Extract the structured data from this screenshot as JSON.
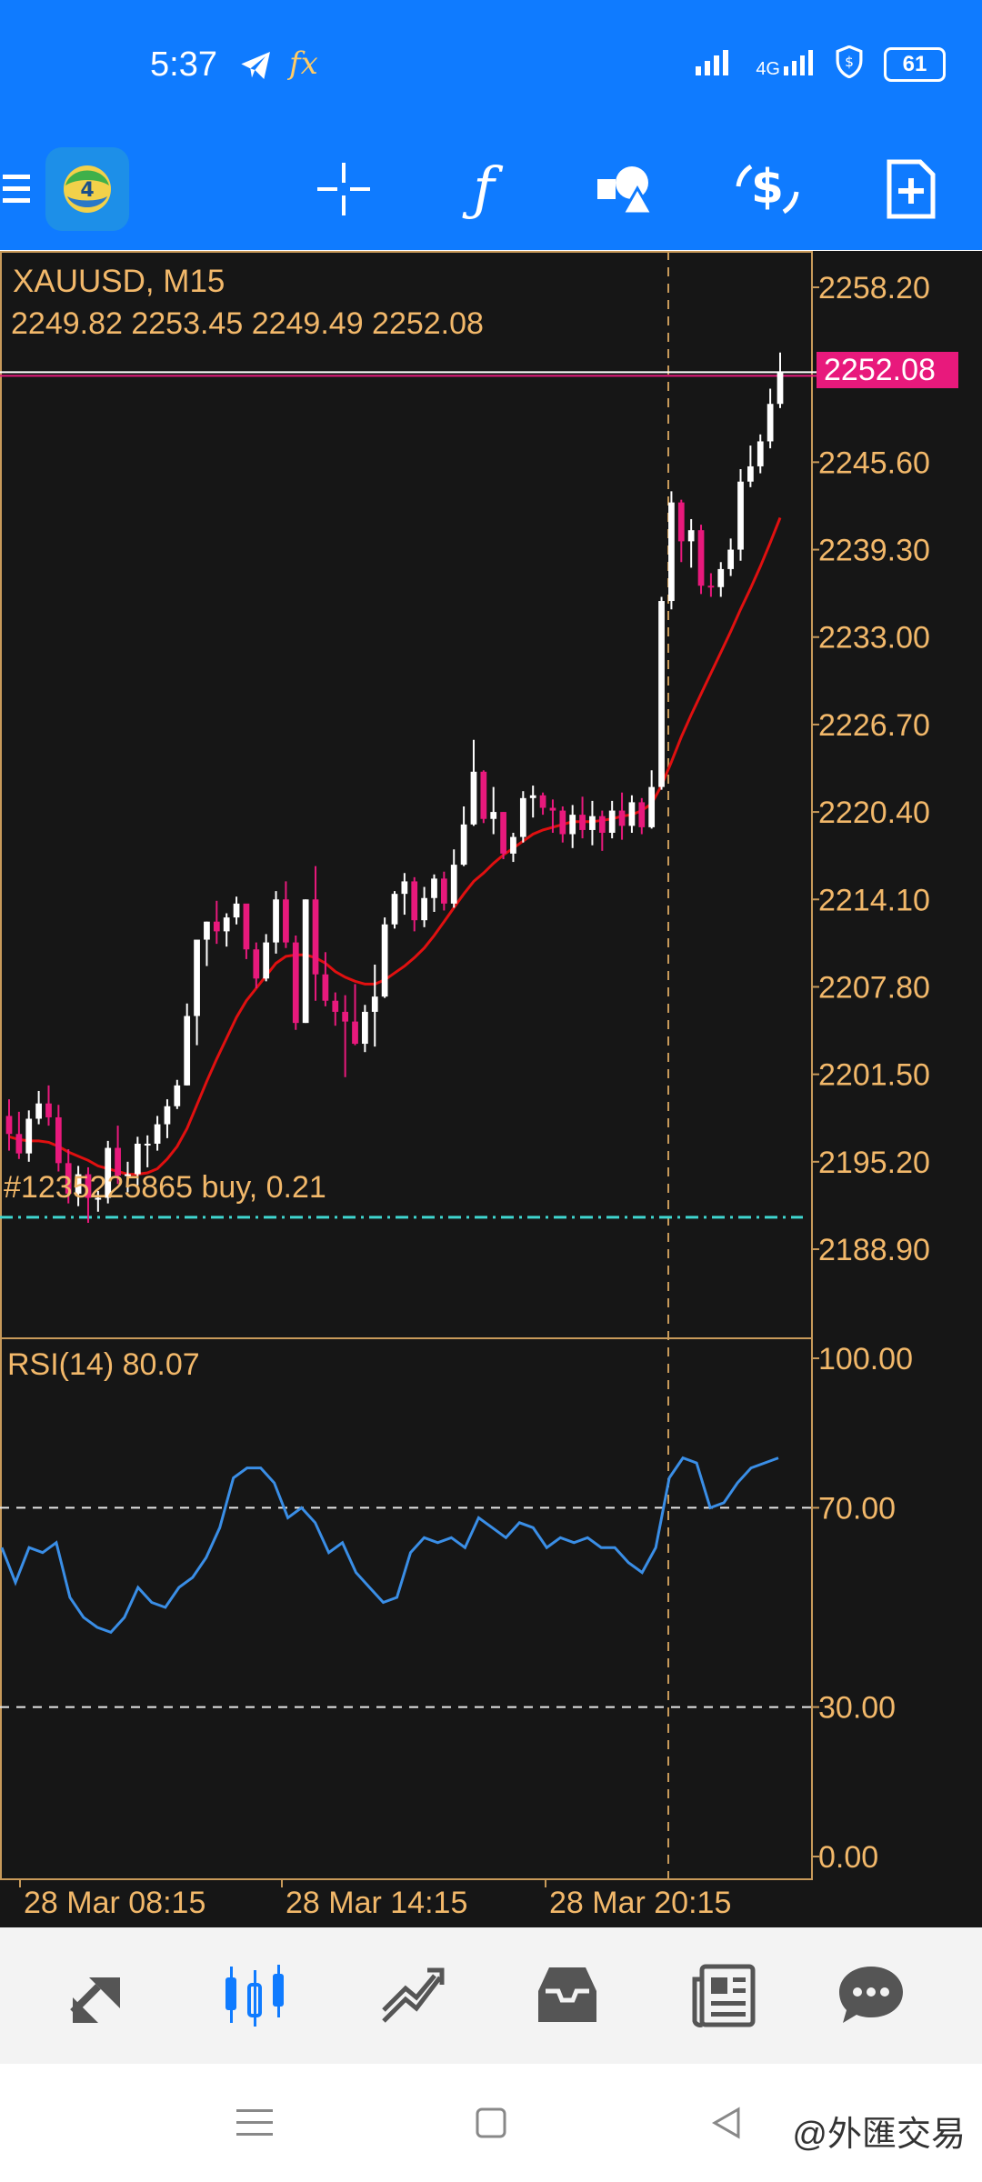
{
  "status_bar": {
    "time": "5:37",
    "network": "4G",
    "battery": "61"
  },
  "toolbar": {
    "icons": [
      "menu-icon",
      "app-logo",
      "crosshair-icon",
      "indicators-icon",
      "objects-icon",
      "trade-icon",
      "new-order-icon"
    ]
  },
  "chart": {
    "symbol": "XAUUSD, M15",
    "ohlc": "2249.82 2253.45 2249.49 2252.08",
    "current_price": "2252.08",
    "price_ticks": [
      "2258.20",
      "2245.60",
      "2239.30",
      "2233.00",
      "2226.70",
      "2220.40",
      "2214.10",
      "2207.80",
      "2201.50",
      "2195.20",
      "2188.90"
    ],
    "order_label": "#1235225865 buy, 0.21",
    "rsi_label": "RSI(14) 80.07",
    "rsi_ticks": [
      "100.00",
      "70.00",
      "30.00",
      "0.00"
    ],
    "time_labels": [
      "28 Mar 08:15",
      "28 Mar 14:15",
      "28 Mar 20:15"
    ],
    "colors": {
      "bull": "#ffffff",
      "bear": "#e8197c",
      "ma": "#e01010",
      "rsi": "#3a8ee6",
      "axis": "#c89a5a",
      "text": "#f2b86a",
      "price_tag": "#e8197c",
      "order_line": "#3fd6d0"
    }
  },
  "chart_data": {
    "type": "candlestick",
    "symbol": "XAUUSD",
    "timeframe": "M15",
    "ylim": [
      2186.5,
      2259.5
    ],
    "current": 2252.08,
    "order_price": 2191.2,
    "candles": [
      [
        2198.5,
        2199.7,
        2196.0,
        2197.2
      ],
      [
        2197.2,
        2198.8,
        2195.4,
        2195.8
      ],
      [
        2195.8,
        2198.9,
        2195.2,
        2198.3
      ],
      [
        2198.3,
        2200.3,
        2197.9,
        2199.4
      ],
      [
        2199.4,
        2200.7,
        2197.8,
        2198.4
      ],
      [
        2198.4,
        2199.3,
        2194.5,
        2195.1
      ],
      [
        2195.1,
        2196.1,
        2192.2,
        2192.9
      ],
      [
        2192.9,
        2194.9,
        2192.0,
        2194.3
      ],
      [
        2194.3,
        2194.8,
        2190.8,
        2192.6
      ],
      [
        2192.6,
        2193.1,
        2191.6,
        2192.6
      ],
      [
        2192.6,
        2196.7,
        2192.2,
        2196.2
      ],
      [
        2196.2,
        2197.8,
        2193.6,
        2194.2
      ],
      [
        2194.2,
        2195.2,
        2193.0,
        2194.3
      ],
      [
        2194.3,
        2197.0,
        2193.5,
        2196.5
      ],
      [
        2196.5,
        2197.1,
        2194.8,
        2196.5
      ],
      [
        2196.5,
        2198.5,
        2196.0,
        2197.9
      ],
      [
        2197.9,
        2199.7,
        2196.9,
        2199.2
      ],
      [
        2199.2,
        2201.1,
        2199.0,
        2200.7
      ],
      [
        2200.7,
        2206.6,
        2200.7,
        2205.7
      ],
      [
        2205.7,
        2211.1,
        2203.6,
        2211.2
      ],
      [
        2211.2,
        2212.5,
        2209.3,
        2212.5
      ],
      [
        2212.5,
        2214.0,
        2210.9,
        2211.8
      ],
      [
        2211.8,
        2213.1,
        2210.7,
        2212.8
      ],
      [
        2212.8,
        2214.3,
        2212.3,
        2213.8
      ],
      [
        2213.8,
        2213.5,
        2209.8,
        2210.5
      ],
      [
        2210.5,
        2211.0,
        2207.7,
        2208.4
      ],
      [
        2208.4,
        2211.6,
        2208.2,
        2211.0
      ],
      [
        2211.0,
        2214.7,
        2210.2,
        2214.1
      ],
      [
        2214.1,
        2215.4,
        2210.6,
        2211.0
      ],
      [
        2211.0,
        2211.5,
        2204.7,
        2205.2
      ],
      [
        2205.2,
        2214.1,
        2205.2,
        2214.1
      ],
      [
        2214.1,
        2216.5,
        2206.8,
        2208.7
      ],
      [
        2208.7,
        2210.3,
        2206.4,
        2206.8
      ],
      [
        2206.8,
        2207.4,
        2205.0,
        2206.0
      ],
      [
        2206.0,
        2207.2,
        2201.3,
        2205.3
      ],
      [
        2205.3,
        2208.0,
        2203.6,
        2203.7
      ],
      [
        2203.7,
        2206.5,
        2203.1,
        2206.0
      ],
      [
        2206.0,
        2209.4,
        2203.5,
        2207.1
      ],
      [
        2207.1,
        2212.8,
        2207.0,
        2212.3
      ],
      [
        2212.3,
        2214.7,
        2212.0,
        2214.5
      ],
      [
        2214.5,
        2216.0,
        2213.0,
        2215.4
      ],
      [
        2215.4,
        2215.7,
        2211.8,
        2212.6
      ],
      [
        2212.6,
        2215.0,
        2212.1,
        2214.2
      ],
      [
        2214.2,
        2215.9,
        2213.2,
        2215.6
      ],
      [
        2215.6,
        2216.1,
        2213.3,
        2213.8
      ],
      [
        2213.8,
        2217.7,
        2213.5,
        2216.6
      ],
      [
        2216.6,
        2220.8,
        2216.5,
        2219.5
      ],
      [
        2219.5,
        2225.6,
        2219.4,
        2223.3
      ],
      [
        2223.3,
        2223.4,
        2219.6,
        2219.9
      ],
      [
        2219.9,
        2222.2,
        2218.8,
        2220.4
      ],
      [
        2220.4,
        2220.4,
        2217.0,
        2217.4
      ],
      [
        2217.4,
        2218.9,
        2216.8,
        2218.6
      ],
      [
        2218.6,
        2221.9,
        2218.2,
        2221.4
      ],
      [
        2221.4,
        2222.3,
        2220.0,
        2221.6
      ],
      [
        2221.6,
        2221.8,
        2220.2,
        2220.7
      ],
      [
        2220.7,
        2221.3,
        2218.9,
        2220.5
      ],
      [
        2220.5,
        2220.8,
        2218.2,
        2218.8
      ],
      [
        2218.8,
        2220.9,
        2217.8,
        2220.2
      ],
      [
        2220.2,
        2221.5,
        2218.5,
        2219.1
      ],
      [
        2219.1,
        2221.2,
        2218.0,
        2220.1
      ],
      [
        2220.1,
        2220.5,
        2217.6,
        2218.9
      ],
      [
        2218.9,
        2221.2,
        2218.5,
        2220.5
      ],
      [
        2220.5,
        2221.8,
        2218.4,
        2219.4
      ],
      [
        2219.4,
        2221.6,
        2218.9,
        2221.1
      ],
      [
        2221.1,
        2221.4,
        2218.8,
        2219.3
      ],
      [
        2219.3,
        2223.4,
        2219.2,
        2222.2
      ],
      [
        2222.2,
        2235.9,
        2222.0,
        2235.6
      ],
      [
        2235.6,
        2243.5,
        2235.0,
        2242.7
      ],
      [
        2242.7,
        2242.9,
        2238.4,
        2239.9
      ],
      [
        2239.9,
        2241.5,
        2238.0,
        2240.7
      ],
      [
        2240.7,
        2241.1,
        2236.1,
        2236.7
      ],
      [
        2236.7,
        2237.6,
        2235.9,
        2236.6
      ],
      [
        2236.6,
        2238.4,
        2235.9,
        2237.9
      ],
      [
        2237.9,
        2240.1,
        2237.4,
        2239.3
      ],
      [
        2239.3,
        2245.1,
        2238.5,
        2244.2
      ],
      [
        2244.2,
        2246.8,
        2243.8,
        2245.3
      ],
      [
        2245.3,
        2247.6,
        2244.8,
        2247.1
      ],
      [
        2247.1,
        2250.9,
        2246.6,
        2249.8
      ],
      [
        2249.8,
        2253.5,
        2249.5,
        2252.1
      ]
    ],
    "ma": [
      2197.0,
      2196.8,
      2196.7,
      2196.7,
      2196.6,
      2196.3,
      2195.9,
      2195.6,
      2195.3,
      2194.9,
      2194.7,
      2194.5,
      2194.3,
      2194.3,
      2194.4,
      2194.7,
      2195.4,
      2196.3,
      2197.6,
      2199.3,
      2201.0,
      2202.6,
      2204.1,
      2205.6,
      2206.8,
      2207.7,
      2208.6,
      2209.5,
      2210.0,
      2210.1,
      2210.1,
      2209.9,
      2209.5,
      2208.9,
      2208.5,
      2208.2,
      2208.0,
      2208.0,
      2208.3,
      2208.8,
      2209.3,
      2209.9,
      2210.6,
      2211.5,
      2212.5,
      2213.5,
      2214.5,
      2215.4,
      2216.0,
      2216.7,
      2217.3,
      2217.8,
      2218.3,
      2218.8,
      2219.1,
      2219.3,
      2219.5,
      2219.7,
      2219.7,
      2219.7,
      2219.8,
      2219.9,
      2220.1,
      2220.2,
      2220.5,
      2221.0,
      2222.3,
      2224.0,
      2225.8,
      2227.4,
      2228.9,
      2230.4,
      2231.9,
      2233.4,
      2235.0,
      2236.5,
      2238.1,
      2239.8,
      2241.6
    ],
    "rsi": [
      62,
      55,
      62,
      61,
      63,
      52,
      48,
      46,
      45,
      48,
      54,
      51,
      50,
      54,
      56,
      60,
      66,
      76,
      78,
      78,
      75,
      68,
      70,
      67,
      61,
      63,
      57,
      54,
      51,
      52,
      61,
      64,
      63,
      64,
      62,
      68,
      66,
      64,
      67,
      66,
      62,
      64,
      63,
      64,
      62,
      62,
      59,
      57,
      62,
      76,
      80,
      79,
      70,
      71,
      75,
      78,
      79,
      80
    ],
    "rsi_levels": [
      70,
      30
    ],
    "x_labels": [
      "28 Mar 08:15",
      "28 Mar 14:15",
      "28 Mar 20:15"
    ]
  },
  "bottom_nav": {
    "items": [
      "quotes-icon",
      "chart-icon",
      "trade-icon",
      "history-icon",
      "news-icon",
      "messages-icon"
    ],
    "active": "chart-icon"
  },
  "system_nav": {
    "watermark": "@外匯交易"
  }
}
